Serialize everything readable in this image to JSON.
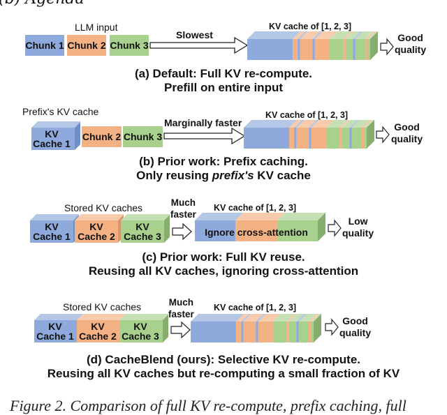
{
  "top_partial_text": "(b) Agenda",
  "colors": {
    "chunk1": "#8ea9db",
    "chunk2": "#f4b183",
    "chunk3": "#a9d18e",
    "chunk1_top": "#b4c7e7",
    "chunk2_top": "#f8cbad",
    "chunk3_top": "#c5e0b4",
    "chunk1_side": "#6f8fc7",
    "chunk2_side": "#d9956a",
    "chunk3_side": "#87ae6e"
  },
  "panel_a": {
    "input_label": "LLM input",
    "chunks": [
      "Chunk 1",
      "Chunk 2",
      "Chunk 3"
    ],
    "arrow_label": "Slowest",
    "kv_label": "KV cache of [1, 2, 3]",
    "quality": [
      "Good",
      "quality"
    ],
    "caption": [
      "(a) Default: Full KV re-compute.",
      "Prefill on entire input"
    ]
  },
  "panel_b": {
    "input_label": "Prefix's KV cache",
    "cache_label": [
      "KV",
      "Cache 1"
    ],
    "chunks": [
      "Chunk 2",
      "Chunk 3"
    ],
    "arrow_label": "Marginally faster",
    "kv_label": "KV cache of [1, 2, 3]",
    "quality": [
      "Good",
      "quality"
    ],
    "caption_line1": "(b) Prior work: Prefix caching.",
    "caption_line2_pre": "Only reusing ",
    "caption_line2_em": "prefix's",
    "caption_line2_post": " KV cache"
  },
  "panel_c": {
    "input_label": "Stored KV caches",
    "caches": [
      [
        "KV",
        "Cache 1"
      ],
      [
        "KV",
        "Cache 2"
      ],
      [
        "KV",
        "Cache 3"
      ]
    ],
    "arrow_label": [
      "Much",
      "faster"
    ],
    "kv_label": "KV cache of [1, 2, 3]",
    "kv_inner_label": "Ignore cross-attention",
    "quality": [
      "Low",
      "quality"
    ],
    "caption": [
      "(c) Prior work: Full KV reuse.",
      "Reusing all KV caches, ignoring cross-attention"
    ]
  },
  "panel_d": {
    "input_label": "Stored KV caches",
    "caches": [
      [
        "KV",
        "Cache 1"
      ],
      [
        "KV",
        "Cache 2"
      ],
      [
        "KV",
        "Cache 3"
      ]
    ],
    "arrow_label": [
      "Much",
      "faster"
    ],
    "kv_label": "KV cache of [1, 2, 3]",
    "quality": [
      "Good",
      "quality"
    ],
    "caption": [
      "(d) CacheBlend (ours): Selective KV re-compute.",
      "Reusing all KV caches but re-computing a small fraction of KV"
    ]
  },
  "bottom_partial_text": "Figure 2. Comparison of full KV re-compute, prefix caching, full"
}
